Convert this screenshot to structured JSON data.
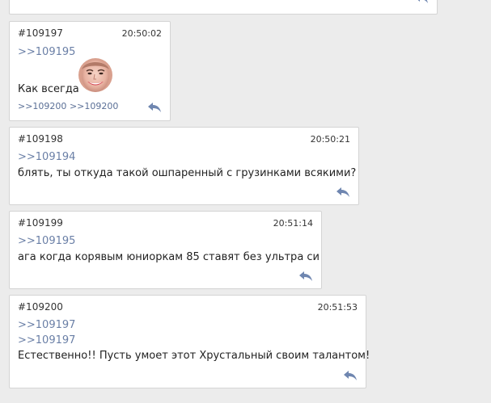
{
  "colors": {
    "link": "#6a7fa6",
    "reply_icon": "#6f86b0",
    "background": "#ececec"
  },
  "posts": [
    {
      "id": "#109197",
      "time": "20:50:02",
      "refs": [
        ">>109195"
      ],
      "text": "Как всегда",
      "emoji": "smiling-face-sticker",
      "replies": [
        ">>109200",
        ">>109200"
      ],
      "reply_icon": "reply-arrow-icon"
    },
    {
      "id": "#109198",
      "time": "20:50:21",
      "refs": [
        ">>109194"
      ],
      "text": "блять, ты откуда такой ошпаренный с грузинками всякими?",
      "reply_icon": "reply-arrow-icon"
    },
    {
      "id": "#109199",
      "time": "20:51:14",
      "refs": [
        ">>109195"
      ],
      "text": "ага когда корявым юниоркам 85 ставят без ультра си",
      "reply_icon": "reply-arrow-icon"
    },
    {
      "id": "#109200",
      "time": "20:51:53",
      "refs": [
        ">>109197",
        ">>109197"
      ],
      "text": "Естественно!! Пусть умоет этот Хрустальный своим талантом!",
      "reply_icon": "reply-arrow-icon"
    }
  ]
}
